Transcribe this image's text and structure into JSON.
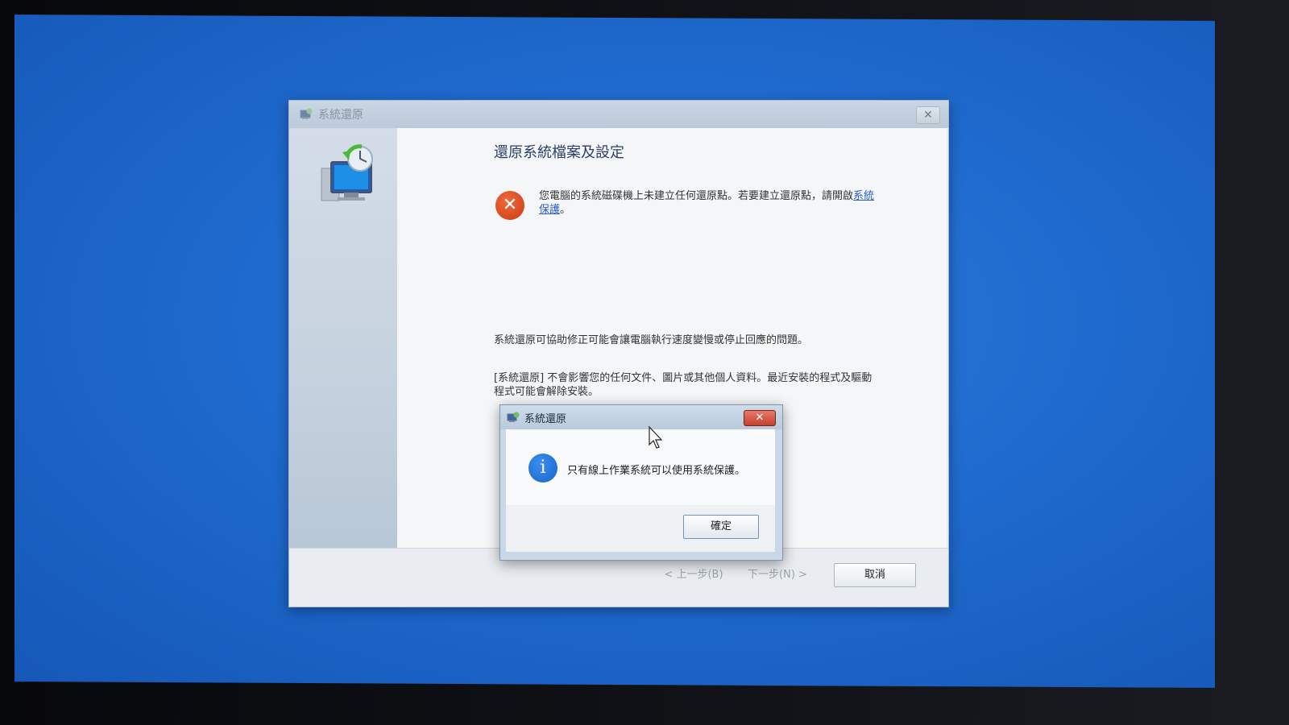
{
  "wizard": {
    "title": "系統還原",
    "close_glyph": "✕",
    "heading": "還原系統檔案及設定",
    "error_icon_glyph": "✕",
    "error_text": "您電腦的系統磁碟機上未建立任何還原點。若要建立還原點，請開啟",
    "error_link": "系統保護",
    "error_text_end": "。",
    "info_paragraph_1": "系統還原可協助修正可能會讓電腦執行速度變慢或停止回應的問題。",
    "info_paragraph_2": "[系統還原] 不會影響您的任何文件、圖片或其他個人資料。最近安裝的程式及驅動程式可能會解除安裝。",
    "back_button": "< 上一步(B)",
    "next_button": "下一步(N) >",
    "cancel_button": "取消"
  },
  "dialog": {
    "title": "系統還原",
    "close_glyph": "✕",
    "info_icon_glyph": "i",
    "message": "只有線上作業系統可以使用系統保護。",
    "ok_button": "確定"
  },
  "icons": {
    "wizard_title_icon": "system-restore-icon",
    "restore_illustration": "system-restore-monitor-icon",
    "error_icon": "error-icon",
    "info_icon": "info-icon",
    "cursor": "mouse-pointer-icon"
  },
  "colors": {
    "desktop": "#1f6ace",
    "error_red": "#cc3a14",
    "info_blue": "#1764c8",
    "link_blue": "#2a5cc4",
    "close_red": "#c4402d"
  }
}
